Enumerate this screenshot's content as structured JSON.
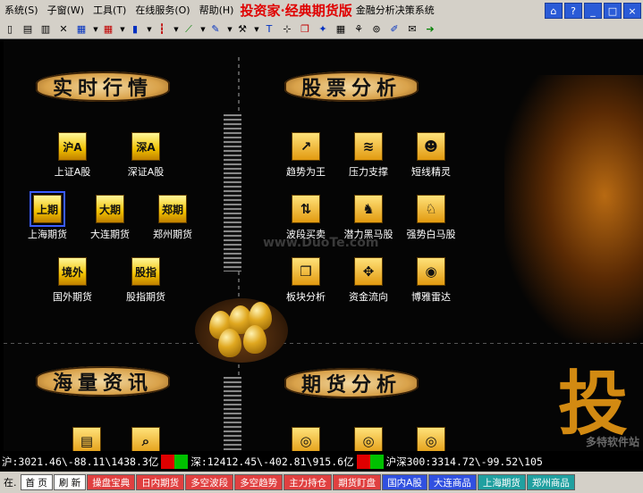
{
  "menu": {
    "items": [
      "系统(S)",
      "子窗(W)",
      "工具(T)",
      "在线服务(O)",
      "帮助(H)"
    ],
    "brand": "投资家·经典期货版",
    "subtitle": "金融分析决策系统"
  },
  "window_buttons": [
    "⌂",
    "?",
    "_",
    "□",
    "×"
  ],
  "toolbar_icons": [
    "new-doc-icon",
    "split-icon",
    "columns-icon",
    "close-x-icon",
    "grid-icon",
    "table-icon",
    "bar-chart-icon",
    "candle-icon",
    "line-chart-icon",
    "news-icon",
    "tools-icon",
    "text-icon",
    "crosshair-icon",
    "layers-icon",
    "magic-icon",
    "calendar-icon",
    "network-icon",
    "binoculars-icon",
    "pen-icon",
    "mail-icon",
    "forward-icon"
  ],
  "sections": {
    "quotes": "实时行情",
    "stock_analysis": "股票分析",
    "info": "海量资讯",
    "futures_analysis": "期货分析"
  },
  "quotes_icons": [
    {
      "label": "上证A股",
      "tag": "沪A"
    },
    {
      "label": "深证A股",
      "tag": "深A"
    },
    {
      "label": "上海期货",
      "tag": "上期"
    },
    {
      "label": "大连期货",
      "tag": "大期"
    },
    {
      "label": "郑州期货",
      "tag": "郑期"
    },
    {
      "label": "国外期货",
      "tag": "境外"
    },
    {
      "label": "股指期货",
      "tag": "股指"
    }
  ],
  "stock_icons": [
    {
      "label": "趋势为王"
    },
    {
      "label": "压力支撑"
    },
    {
      "label": "短线精灵"
    },
    {
      "label": "波段买卖"
    },
    {
      "label": "潜力黑马股"
    },
    {
      "label": "强势白马股"
    },
    {
      "label": "板块分析"
    },
    {
      "label": "资金流向"
    },
    {
      "label": "博雅雷达"
    }
  ],
  "watermark": "www.DuoTe.com",
  "big_char": "投",
  "corner_logo": "多特软件站",
  "ticker": {
    "lead": "沪",
    "sh": "沪:3021.46\\-88.11\\1438.3亿",
    "sz": "深:12412.45\\-402.81\\915.6亿",
    "hs300": "沪深300:3314.72\\-99.52\\105"
  },
  "status_left": "在.",
  "tabs": [
    {
      "label": "首 页",
      "style": "t1"
    },
    {
      "label": "刷 新",
      "style": "t1"
    },
    {
      "label": "操盘宝典",
      "style": "t2"
    },
    {
      "label": "日内期货",
      "style": "t2"
    },
    {
      "label": "多空波段",
      "style": "t2"
    },
    {
      "label": "多空趋势",
      "style": "t2"
    },
    {
      "label": "主力持仓",
      "style": "t2"
    },
    {
      "label": "期货盯盘",
      "style": "t2"
    },
    {
      "label": "国内A股",
      "style": "t3"
    },
    {
      "label": "大连商品",
      "style": "t3"
    },
    {
      "label": "上海期货",
      "style": "t4"
    },
    {
      "label": "郑州商品",
      "style": "t4"
    }
  ]
}
